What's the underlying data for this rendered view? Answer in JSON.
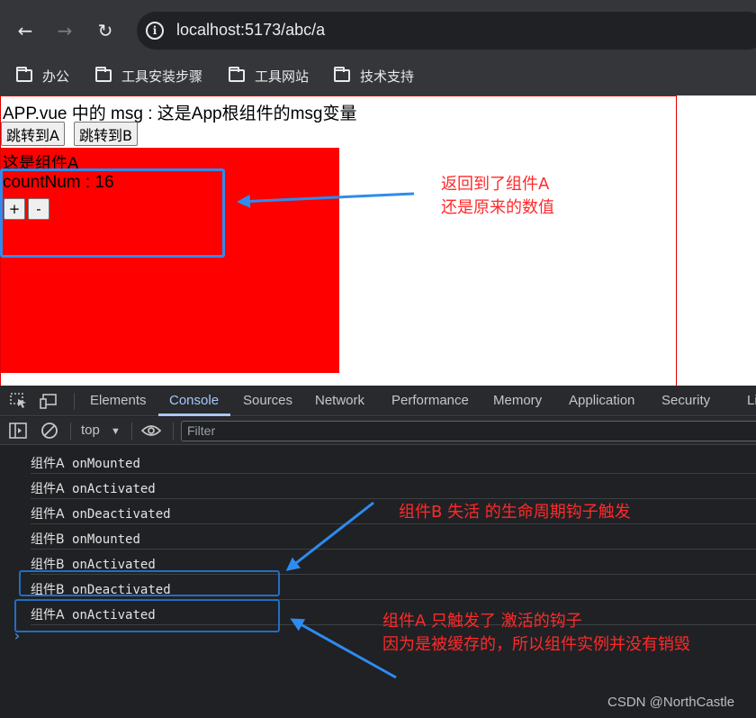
{
  "browser": {
    "url": "localhost:5173/abc/a",
    "bookmarks": [
      {
        "label": "办公"
      },
      {
        "label": "工具安装步骤"
      },
      {
        "label": "工具网站"
      },
      {
        "label": "技术支持"
      }
    ]
  },
  "page": {
    "app_msg": "APP.vue 中的 msg : 这是App根组件的msg变量",
    "btn_to_a": "跳转到A",
    "btn_to_b": "跳转到B",
    "comp_a_title": "这是组件A",
    "count_text": "countNum : 16",
    "plus_label": "+",
    "minus_label": "-"
  },
  "annotations": {
    "note_top_line1": "返回到了组件A",
    "note_top_line2": "还是原来的数值",
    "note_mid": "组件B 失活 的生命周期钩子触发",
    "note_bottom_line1": "组件A 只触发了 激活的钩子",
    "note_bottom_line2": "因为是被缓存的，所以组件实例并没有销毁",
    "color": "#ff2a2a",
    "highlight_color": "#2d8cf0"
  },
  "devtools": {
    "tabs": [
      "Elements",
      "Console",
      "Sources",
      "Network",
      "Performance",
      "Memory",
      "Application",
      "Security",
      "Li"
    ],
    "active_tab": "Console",
    "context": "top",
    "filter_placeholder": "Filter",
    "logs": [
      {
        "name": "组件A",
        "hook": "onMounted"
      },
      {
        "name": "组件A",
        "hook": "onActivated"
      },
      {
        "name": "组件A",
        "hook": "onDeactivated"
      },
      {
        "name": "组件B",
        "hook": "onMounted"
      },
      {
        "name": "组件B",
        "hook": "onActivated"
      },
      {
        "name": "组件B",
        "hook": "onDeactivated"
      },
      {
        "name": "组件A",
        "hook": "onActivated"
      }
    ],
    "prompt": "›"
  },
  "watermark": "CSDN @NorthCastle"
}
